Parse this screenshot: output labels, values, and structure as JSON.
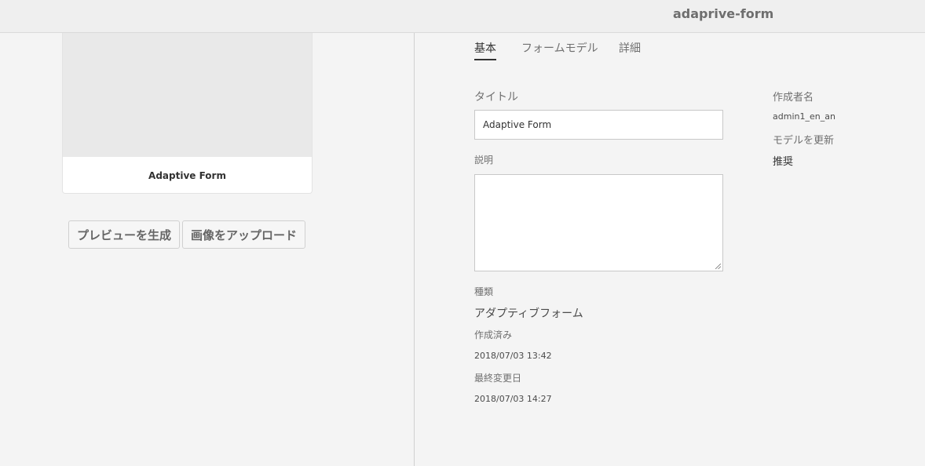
{
  "header": {
    "title": "adaprive-form"
  },
  "card": {
    "title": "Adaptive Form"
  },
  "buttons": {
    "preview": "プレビューを生成",
    "upload": "画像をアップロード"
  },
  "tabs": [
    {
      "label": "基本",
      "active": true
    },
    {
      "label": "フォームモデル",
      "active": false
    },
    {
      "label": "詳細",
      "active": false
    }
  ],
  "form": {
    "title_label": "タイトル",
    "title_value": "Adaptive Form",
    "description_label": "説明",
    "description_value": "",
    "type_label": "種類",
    "type_value": "アダプティブフォーム",
    "created_label": "作成済み",
    "created_value": "2018/07/03 13:42",
    "modified_label": "最終変更日",
    "modified_value": "2018/07/03 14:27"
  },
  "sidebar": {
    "author_label": "作成者名",
    "author_value": "admin1_en_an",
    "update_model_label": "モデルを更新",
    "update_model_value": "推奨"
  }
}
